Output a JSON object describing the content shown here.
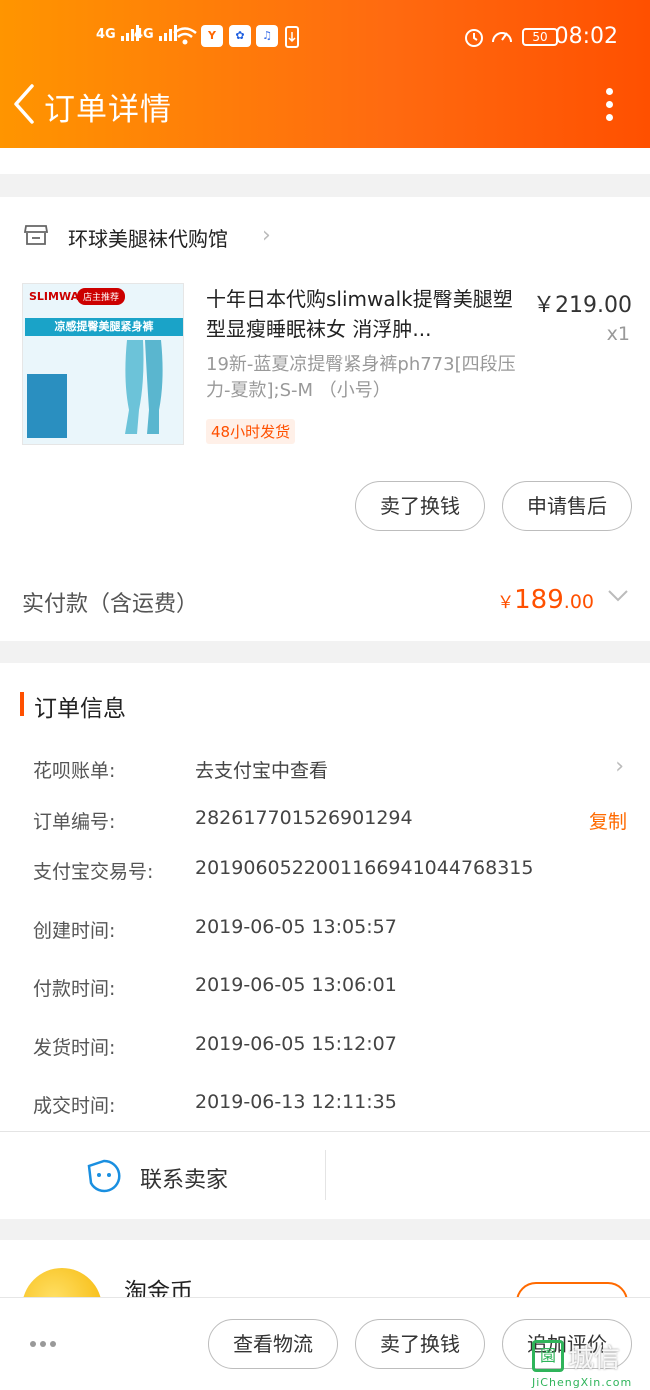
{
  "status_bar": {
    "signal_1": "4G",
    "signal_2": "4G",
    "battery": "50",
    "time": "08:02",
    "app_icons": [
      "yixiu-app-icon",
      "baidu-paw-icon",
      "music-note-icon",
      "sim-icon"
    ]
  },
  "header": {
    "title": "订单详情",
    "back_icon": "chevron-left-icon",
    "more_icon": "more-vertical-icon",
    "gradient_start": "#ff9500",
    "gradient_end": "#ff5000"
  },
  "store": {
    "name": "环球美腿袜代购馆"
  },
  "product": {
    "image_logo": "SLIMWALK",
    "image_tag": "店主推荐",
    "image_band": "凉感提臀美腿紧身裤",
    "title": "十年日本代购slimwalk提臀美腿塑型显瘦睡眠袜女 消浮肿...",
    "price": "￥219.00",
    "quantity": "x1",
    "sku": "19新-蓝夏凉提臀紧身裤ph773[四段压力-夏款];S-M （小号）",
    "ship_badge": "48小时发货",
    "buttons": {
      "sell": "卖了换钱",
      "after_sale": "申请售后"
    }
  },
  "payment": {
    "label": "实付款（含运费）",
    "currency": "￥",
    "amount_int": "189",
    "amount_dec": ".00",
    "accent": "#ff5000"
  },
  "order_info": {
    "title": "订单信息",
    "rows": [
      {
        "label": "花呗账单:",
        "value": "去支付宝中查看"
      },
      {
        "label": "订单编号:",
        "value": "282617701526901294",
        "action": "复制"
      },
      {
        "label": "支付宝交易号:",
        "value": "2019060522001166941044768315"
      },
      {
        "label": "创建时间:",
        "value": "2019-06-05 13:05:57"
      },
      {
        "label": "付款时间:",
        "value": "2019-06-05 13:06:01"
      },
      {
        "label": "发货时间:",
        "value": "2019-06-05 15:12:07"
      },
      {
        "label": "成交时间:",
        "value": "2019-06-13 12:11:35"
      }
    ],
    "contact": "联系卖家"
  },
  "coin": {
    "label": "淘金币"
  },
  "bottom_bar": {
    "logistics": "查看物流",
    "sell": "卖了换钱",
    "review": "追加评价"
  },
  "watermark": {
    "cn": "城信",
    "url": "JiChengXin.com",
    "color": "#2fb45a"
  }
}
